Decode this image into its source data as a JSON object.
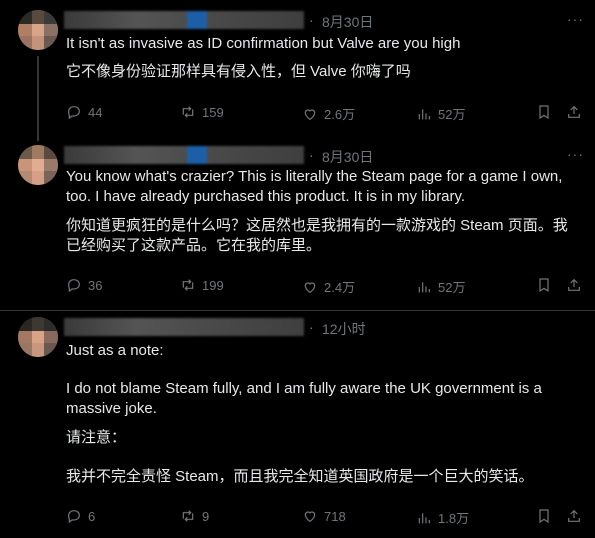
{
  "posts": [
    {
      "time": "8月30日",
      "text_en": "It isn't as invasive as ID confirmation but Valve are you high",
      "text_zh": "它不像身份验证那样具有侵入性，但 Valve 你嗨了吗",
      "replies": "44",
      "reposts": "159",
      "likes": "2.6万",
      "views": "52万"
    },
    {
      "time": "8月30日",
      "text_en": "You know what's crazier? This is literally the Steam page for a game I own, too. I have already purchased this product. It is in my library.",
      "text_zh": "你知道更疯狂的是什么吗？这居然也是我拥有的一款游戏的 Steam 页面。我已经购买了这款产品。它在我的库里。",
      "replies": "36",
      "reposts": "199",
      "likes": "2.4万",
      "views": "52万"
    },
    {
      "time": "12小时",
      "text_en_1": "Just as a note:",
      "text_en_2": "I do not blame Steam fully, and I am fully aware the UK government is a massive joke.",
      "text_zh_1": "请注意：",
      "text_zh_2": "我并不完全责怪 Steam，而且我完全知道英国政府是一个巨大的笑话。",
      "replies": "6",
      "reposts": "9",
      "likes": "718",
      "views": "1.8万"
    }
  ],
  "dot_separator": "·",
  "more_glyph": "···"
}
